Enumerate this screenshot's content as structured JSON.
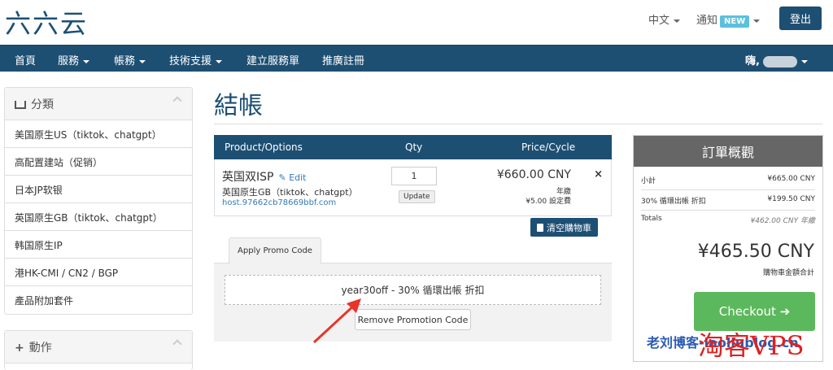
{
  "header": {
    "logo": "六六云",
    "language": "中文",
    "notifications": "通知",
    "new_badge": "NEW",
    "logout": "登出"
  },
  "nav": {
    "items": [
      "首頁",
      "服務",
      "帳務",
      "技術支援",
      "建立服務單",
      "推廣註冊"
    ],
    "greeting": "嗨,"
  },
  "sidebar": {
    "categories_title": "分類",
    "categories": [
      "美国原生US（tiktok、chatgpt）",
      "高配置建站（促销）",
      "日本JP软银",
      "英国原生GB（tiktok、chatgpt）",
      "韩国原生IP",
      "港HK-CMI / CN2 / BGP",
      "產品附加套件"
    ],
    "actions_title": "動作"
  },
  "main": {
    "title": "結帳",
    "cart_headers": {
      "product": "Product/Options",
      "qty": "Qty",
      "price": "Price/Cycle"
    },
    "item": {
      "name": "英国双ISP",
      "edit": "Edit",
      "subtitle": "英国原生GB（tiktok、chatgpt）",
      "host": "host.97662cb78669bbf.com",
      "qty": "1",
      "update": "Update",
      "price": "¥660.00 CNY",
      "cycle": "年繳",
      "setup_fee": "¥5.00 設定費",
      "remove": "×"
    },
    "empty_cart": "清空購物車",
    "promo": {
      "tab": "Apply Promo Code",
      "applied": "year30off - 30% 循環出帳 折扣",
      "remove_button": "Remove Promotion Code"
    }
  },
  "summary": {
    "title": "訂單概觀",
    "subtotal_label": "小計",
    "subtotal_value": "¥665.00 CNY",
    "discount_label": "30% 循環出帳 折扣",
    "discount_value": "¥199.50 CNY",
    "totals_label": "Totals",
    "totals_value": "¥462.00 CNY 年繳",
    "total_amount": "¥465.50 CNY",
    "total_label": "購物車金額合計",
    "checkout": "Checkout"
  },
  "watermark": {
    "text1": "老刘博客-laoliublog.cn",
    "text2": "淘客VPS"
  },
  "colors": {
    "brand": "#1d4f73",
    "checkout": "#5cb85c",
    "summary_header": "#666666",
    "badge": "#5bc0de"
  }
}
